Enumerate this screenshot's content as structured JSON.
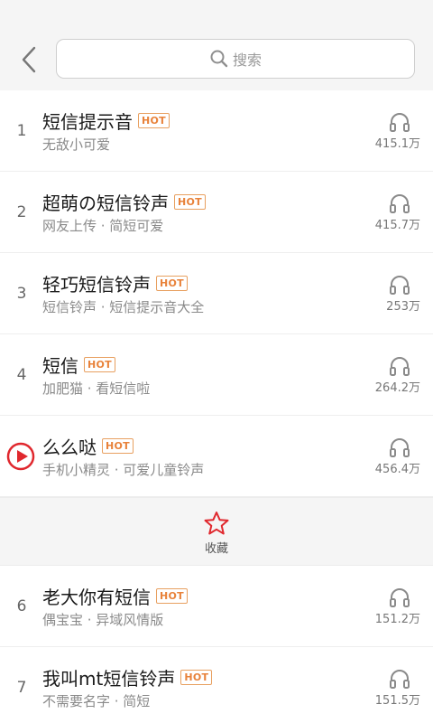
{
  "header": {
    "search_placeholder": "搜索"
  },
  "songs": [
    {
      "rank": "1",
      "title": "短信提示音",
      "badge": "HOT",
      "subtitle": "无敌小可爱",
      "plays": "415.1万",
      "playing": false
    },
    {
      "rank": "2",
      "title": "超萌の短信铃声",
      "badge": "HOT",
      "subtitle": "网友上传 · 简短可爱",
      "plays": "415.7万",
      "playing": false
    },
    {
      "rank": "3",
      "title": "轻巧短信铃声",
      "badge": "HOT",
      "subtitle": "短信铃声 · 短信提示音大全",
      "plays": "253万",
      "playing": false
    },
    {
      "rank": "4",
      "title": "短信",
      "badge": "HOT",
      "subtitle": "加肥猫 · 看短信啦",
      "plays": "264.2万",
      "playing": false
    },
    {
      "rank": "5",
      "title": "么么哒",
      "badge": "HOT",
      "subtitle": "手机小精灵 · 可爱儿童铃声",
      "plays": "456.4万",
      "playing": true
    },
    {
      "rank": "6",
      "title": "老大你有短信",
      "badge": "HOT",
      "subtitle": "偶宝宝 · 异域风情版",
      "plays": "151.2万",
      "playing": false
    },
    {
      "rank": "7",
      "title": "我叫mt短信铃声",
      "badge": "HOT",
      "subtitle": "不需要名字 · 简短",
      "plays": "151.5万",
      "playing": false
    }
  ],
  "favorite": {
    "label": "收藏"
  },
  "colors": {
    "accent": "#e0282e",
    "hot_badge": "#e8823a",
    "header_bg": "#f5f5f5"
  },
  "icons": {
    "back": "chevron-left-icon",
    "search": "search-icon",
    "plays": "headphone-icon",
    "play": "play-icon",
    "favorite": "star-icon"
  }
}
